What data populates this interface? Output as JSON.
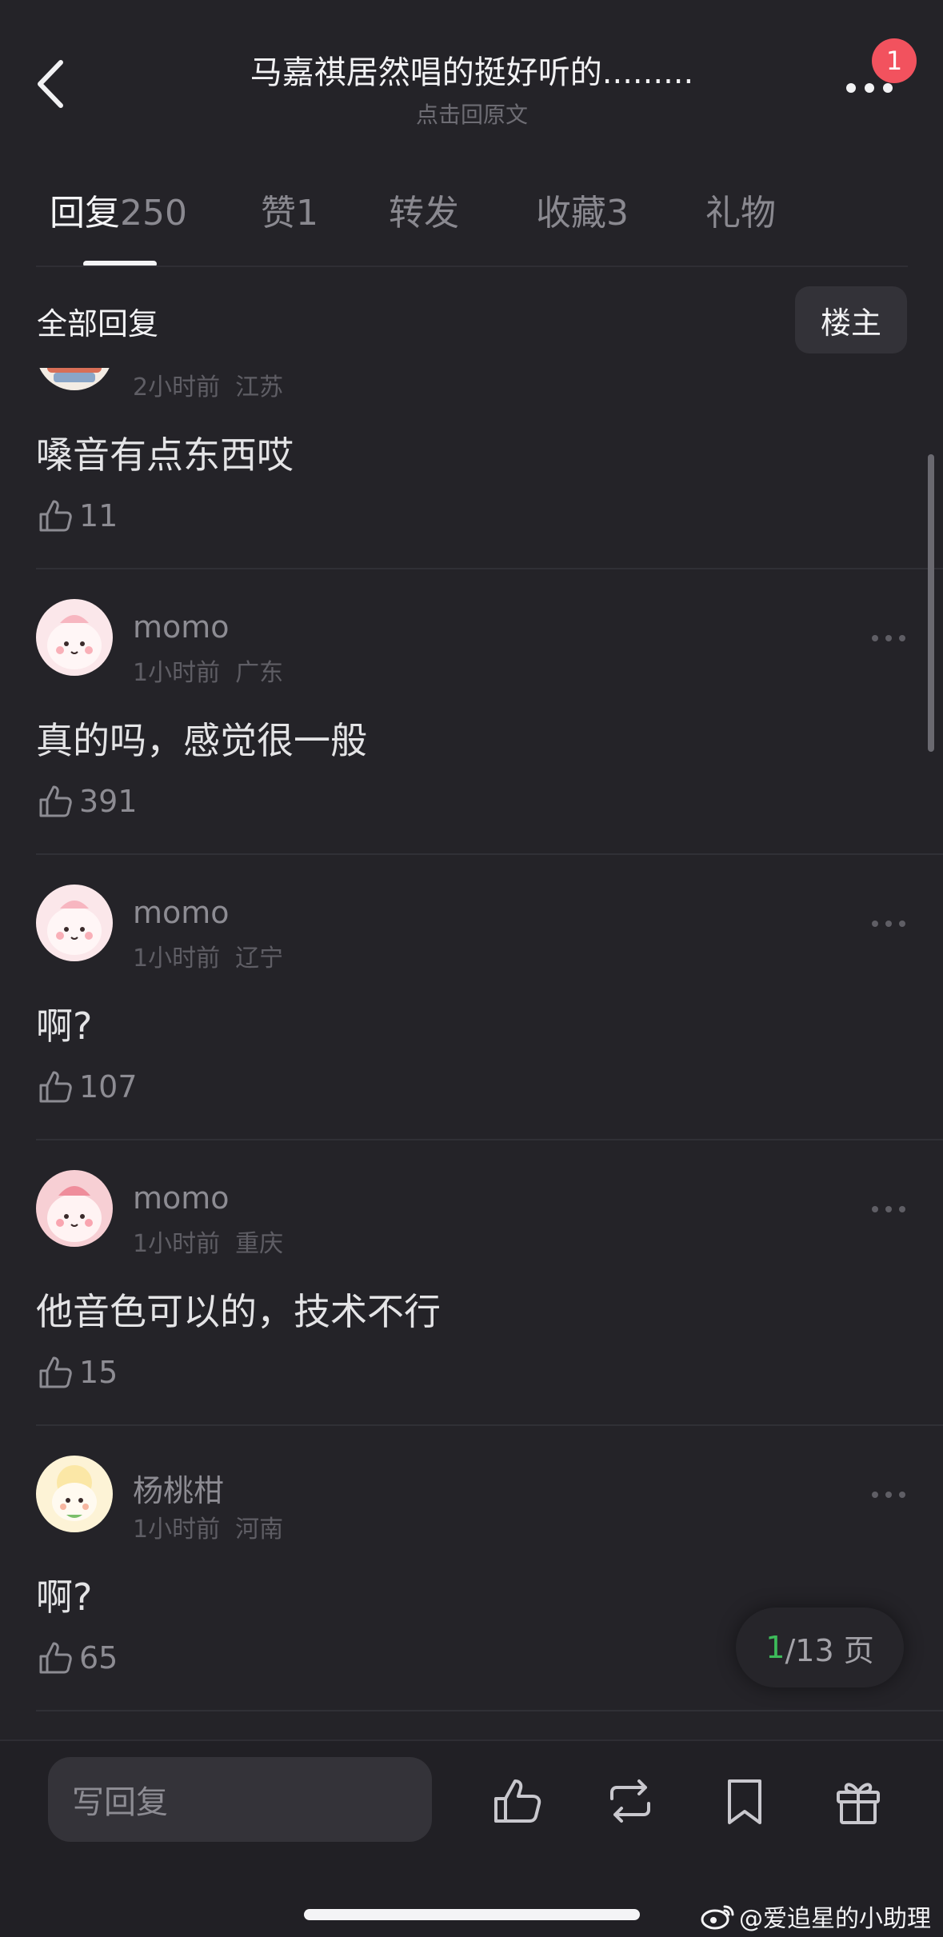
{
  "header": {
    "title": "马嘉祺居然唱的挺好听的.........",
    "subtitle": "点击回原文",
    "notification_count": "1"
  },
  "tabs": [
    {
      "label": "回复",
      "count": "250",
      "active": true
    },
    {
      "label": "赞",
      "count": "1",
      "active": false
    },
    {
      "label": "转发",
      "count": "",
      "active": false
    },
    {
      "label": "收藏",
      "count": "3",
      "active": false
    },
    {
      "label": "礼物",
      "count": "",
      "active": false
    }
  ],
  "filter": {
    "label": "全部回复",
    "owner_button": "楼主"
  },
  "comments": [
    {
      "username": "",
      "meta": "2小时前  江苏",
      "content": "嗓音有点东西哎",
      "likes": "11"
    },
    {
      "username": "momo",
      "meta": "1小时前  广东",
      "content": "真的吗，感觉很一般",
      "likes": "391"
    },
    {
      "username": "momo",
      "meta": "1小时前  辽宁",
      "content": "啊?",
      "likes": "107"
    },
    {
      "username": "momo",
      "meta": "1小时前  重庆",
      "content": "他音色可以的，技术不行",
      "likes": "15"
    },
    {
      "username": "杨桃柑",
      "meta": "1小时前  河南",
      "content": "啊?",
      "likes": "65"
    }
  ],
  "pager": {
    "current": "1",
    "total": "/13 页"
  },
  "bottom_bar": {
    "reply_placeholder": "写回复"
  },
  "watermark": "@爱追星的小助理",
  "colors": {
    "background": "#242328",
    "badge": "#f2525e",
    "pager_current": "#3dbb5a"
  }
}
